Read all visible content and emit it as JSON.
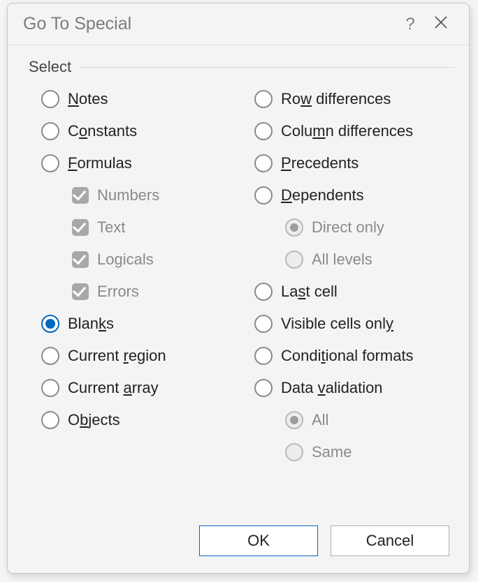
{
  "dialog": {
    "title": "Go To Special",
    "group_label": "Select"
  },
  "left": {
    "notes": {
      "pre": "",
      "u": "N",
      "post": "otes"
    },
    "constants": {
      "pre": "C",
      "u": "o",
      "post": "nstants"
    },
    "formulas": {
      "pre": "",
      "u": "F",
      "post": "ormulas"
    },
    "numbers": "Numbers",
    "text": "Text",
    "logicals": "Logicals",
    "errors": "Errors",
    "blanks": {
      "pre": "Blan",
      "u": "k",
      "post": "s"
    },
    "current_region": {
      "pre": "Current ",
      "u": "r",
      "post": "egion"
    },
    "current_array": {
      "pre": "Current ",
      "u": "a",
      "post": "rray"
    },
    "objects": {
      "pre": "O",
      "u": "b",
      "post": "jects"
    }
  },
  "right": {
    "row_diff": {
      "pre": "Ro",
      "u": "w",
      "post": " differences"
    },
    "col_diff": {
      "pre": "Colu",
      "u": "m",
      "post": "n differences"
    },
    "precedents": {
      "pre": "",
      "u": "P",
      "post": "recedents"
    },
    "dependents": {
      "pre": "",
      "u": "D",
      "post": "ependents"
    },
    "direct_only": "Direct only",
    "all_levels": "All levels",
    "last_cell": {
      "pre": "La",
      "u": "s",
      "post": "t cell"
    },
    "visible": {
      "pre": "Visible cells onl",
      "u": "y",
      "post": ""
    },
    "cond_formats": {
      "pre": "Condi",
      "u": "t",
      "post": "ional formats"
    },
    "data_validation": {
      "pre": "Data ",
      "u": "v",
      "post": "alidation"
    },
    "all": "All",
    "same": "Same"
  },
  "buttons": {
    "ok": "OK",
    "cancel": "Cancel"
  }
}
